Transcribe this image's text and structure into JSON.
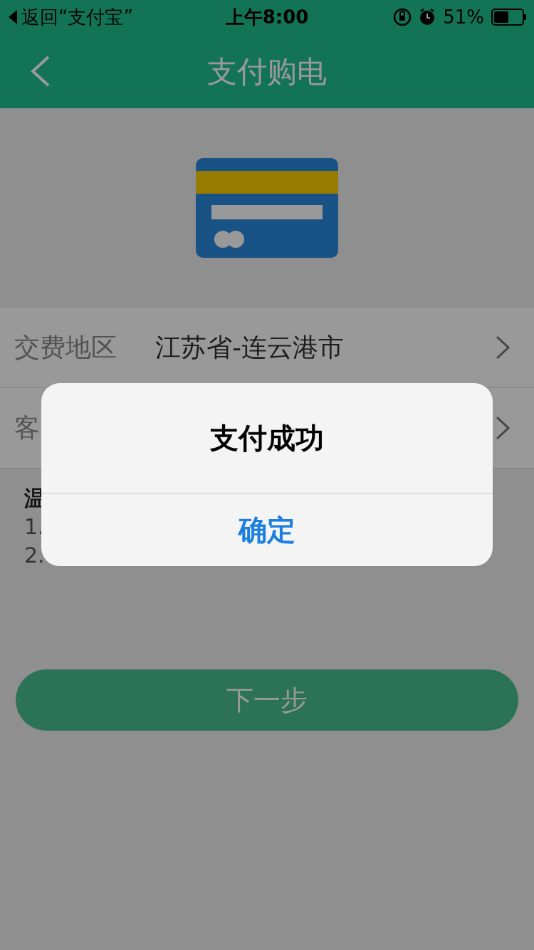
{
  "status_bar": {
    "back_label": "返回“支付宝”",
    "time": "上午8:00",
    "battery": "51%"
  },
  "nav": {
    "title": "支付购电"
  },
  "rows": [
    {
      "label": "交费地区",
      "value": "江苏省-连云港市"
    },
    {
      "label": "客"
    }
  ],
  "tips": {
    "title": "温",
    "items": [
      "1.",
      "2."
    ]
  },
  "next_button": "下一步",
  "dialog": {
    "title": "支付成功",
    "button": "确定"
  }
}
